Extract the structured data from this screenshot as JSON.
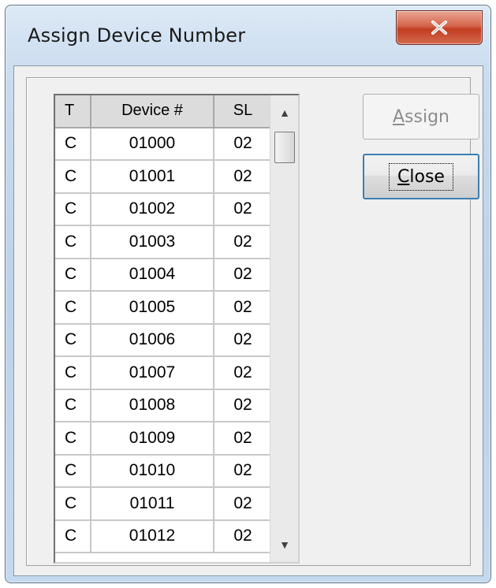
{
  "window": {
    "title": "Assign Device Number",
    "close_icon": "close-x-icon"
  },
  "grid": {
    "columns": [
      "T",
      "Device #",
      "SL"
    ],
    "rows": [
      [
        "C",
        "01000",
        "02"
      ],
      [
        "C",
        "01001",
        "02"
      ],
      [
        "C",
        "01002",
        "02"
      ],
      [
        "C",
        "01003",
        "02"
      ],
      [
        "C",
        "01004",
        "02"
      ],
      [
        "C",
        "01005",
        "02"
      ],
      [
        "C",
        "01006",
        "02"
      ],
      [
        "C",
        "01007",
        "02"
      ],
      [
        "C",
        "01008",
        "02"
      ],
      [
        "C",
        "01009",
        "02"
      ],
      [
        "C",
        "01010",
        "02"
      ],
      [
        "C",
        "01011",
        "02"
      ],
      [
        "C",
        "01012",
        "02"
      ]
    ]
  },
  "scrollbar": {
    "up_icon": "scroll-up-arrow-icon",
    "down_icon": "scroll-down-arrow-icon"
  },
  "buttons": {
    "assign": {
      "label_mnemonic": "A",
      "label_rest": "ssign",
      "enabled": false
    },
    "close": {
      "label_mnemonic": "C",
      "label_rest": "lose",
      "enabled": true
    }
  },
  "colors": {
    "close_button_red": "#c23c22",
    "default_button_border": "#3c7fb1"
  }
}
